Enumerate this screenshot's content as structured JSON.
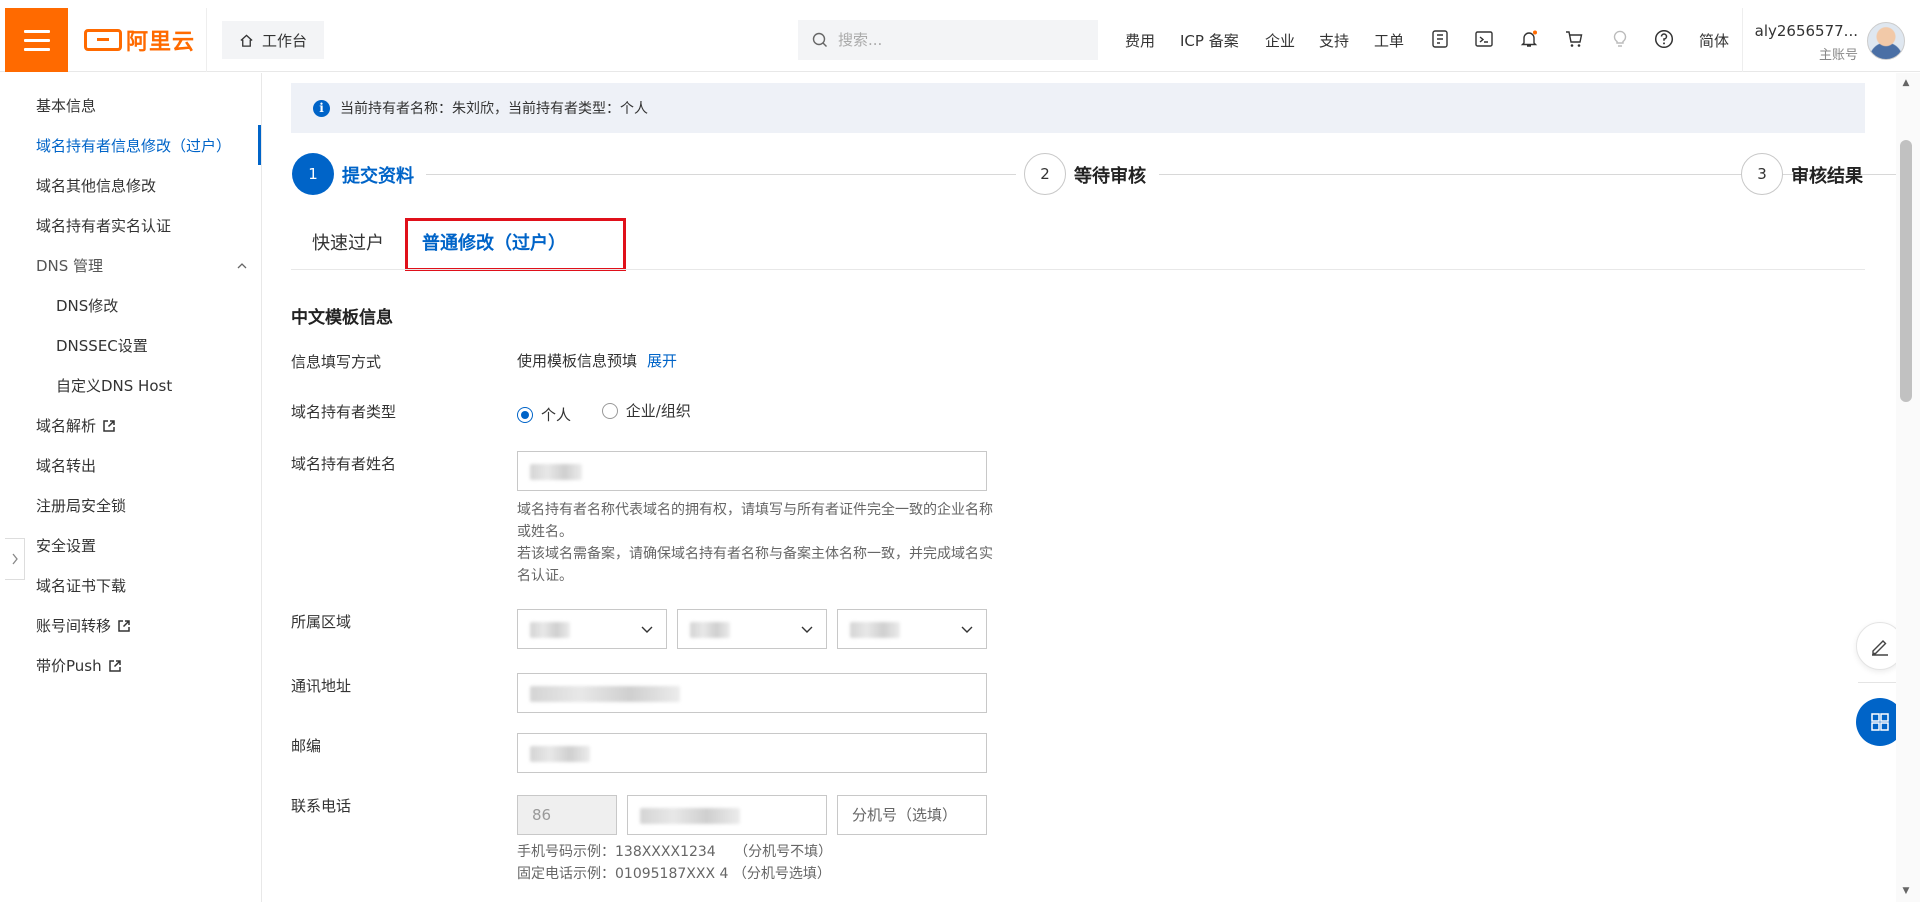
{
  "topbar": {
    "logo_text": "阿里云",
    "workbench_label": "工作台",
    "search_placeholder": "搜索...",
    "nav": [
      "费用",
      "ICP 备案",
      "企业",
      "支持",
      "工单"
    ],
    "lang": "简体",
    "username": "aly2656577...",
    "account_type": "主账号"
  },
  "sidebar": {
    "items": [
      {
        "label": "基本信息"
      },
      {
        "label": "域名持有者信息修改（过户）"
      },
      {
        "label": "域名其他信息修改"
      },
      {
        "label": "域名持有者实名认证"
      },
      {
        "label": "DNS 管理"
      },
      {
        "label": "DNS修改"
      },
      {
        "label": "DNSSEC设置"
      },
      {
        "label": "自定义DNS Host"
      },
      {
        "label": "域名解析"
      },
      {
        "label": "域名转出"
      },
      {
        "label": "注册局安全锁"
      },
      {
        "label": "安全设置"
      },
      {
        "label": "域名证书下载"
      },
      {
        "label": "账号间转移"
      },
      {
        "label": "带价Push"
      }
    ]
  },
  "notice": "当前持有者名称：朱刘欣，当前持有者类型：个人",
  "steps": [
    {
      "num": "1",
      "label": "提交资料"
    },
    {
      "num": "2",
      "label": "等待审核"
    },
    {
      "num": "3",
      "label": "审核结果"
    }
  ],
  "tabs": [
    "快速过户",
    "普通修改（过户）"
  ],
  "form": {
    "section_title": "中文模板信息",
    "fill_method_label": "信息填写方式",
    "fill_method_value": "使用模板信息预填",
    "fill_method_link": "展开",
    "holder_type_label": "域名持有者类型",
    "holder_type_options": [
      "个人",
      "企业/组织"
    ],
    "holder_name_label": "域名持有者姓名",
    "holder_name_help": "域名持有者名称代表域名的拥有权，请填写与所有者证件完全一致的企业名称或姓名。",
    "holder_name_help2": "若该域名需备案，请确保域名持有者名称与备案主体名称一致，并完成域名实名认证。",
    "region_label": "所属区域",
    "address_label": "通讯地址",
    "postcode_label": "邮编",
    "phone_label": "联系电话",
    "phone_country_code": "86",
    "phone_ext_placeholder": "分机号（选填）",
    "phone_example_mobile": "手机号码示例：138XXXX1234　 （分机号不填）",
    "phone_example_fixed": "固定电话示例：01095187XXX 4 （分机号选填）"
  }
}
